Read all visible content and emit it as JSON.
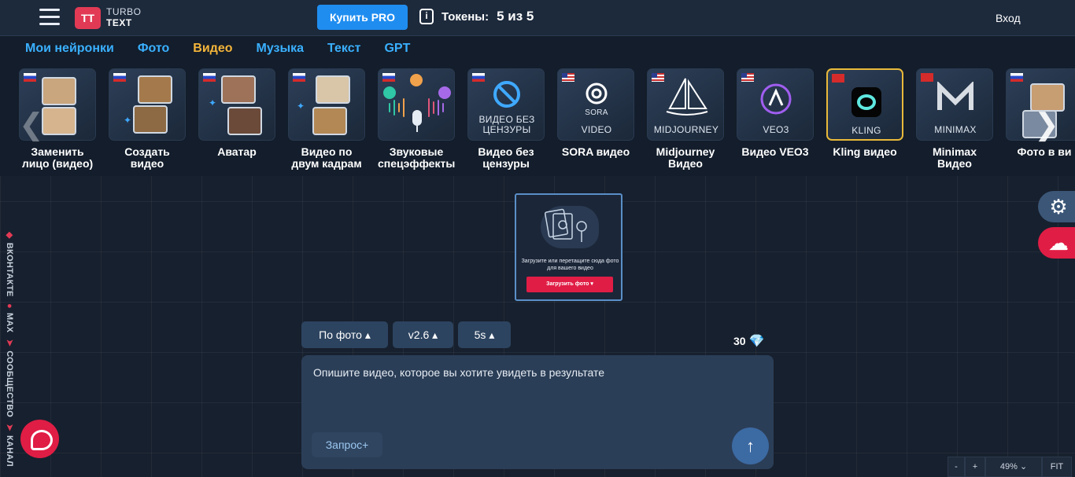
{
  "header": {
    "logo_mark": "TT",
    "logo_line1": "TURBO",
    "logo_line2": "TEXT",
    "pro_button": "Купить PRO",
    "tokens_label": "Токены:",
    "tokens_value": "5 из 5",
    "login": "Вход"
  },
  "tabs": [
    {
      "label": "Мои нейронки"
    },
    {
      "label": "Фото"
    },
    {
      "label": "Видео",
      "active": true
    },
    {
      "label": "Музыка"
    },
    {
      "label": "Текст"
    },
    {
      "label": "GPT"
    }
  ],
  "cards": [
    {
      "label": "Заменить лицо (видео)",
      "flag": "ru"
    },
    {
      "label": "Создать видео",
      "flag": "ru"
    },
    {
      "label": "Аватар",
      "flag": "ru"
    },
    {
      "label": "Видео по двум кадрам",
      "flag": "ru"
    },
    {
      "label": "Звуковые спецэффекты",
      "flag": "ru"
    },
    {
      "label": "Видео без цензуры",
      "flag": "ru",
      "cap": "ВИДЕО БЕЗ ЦЕНЗУРЫ"
    },
    {
      "label": "SORA видео",
      "flag": "us",
      "cap": "SORA",
      "cap2": "VIDEO"
    },
    {
      "label": "Midjourney Видео",
      "flag": "us",
      "cap": "MIDJOURNEY"
    },
    {
      "label": "Видео VEO3",
      "flag": "us",
      "cap": "VEO3"
    },
    {
      "label": "Kling видео",
      "flag": "cn",
      "cap": "KLING",
      "active": true
    },
    {
      "label": "Minimax Видео",
      "flag": "cn",
      "cap": "MINIMAX"
    },
    {
      "label": "Фото в ви",
      "flag": "ru"
    }
  ],
  "upload": {
    "text": "Загрузите или перетащите сюда фото для вашего видео",
    "button": "Загрузить фото"
  },
  "options": {
    "mode": "По фото",
    "version": "v2.6",
    "duration": "5s"
  },
  "cost": "30",
  "prompt": {
    "placeholder": "Опишите видео, которое вы хотите увидеть в результате",
    "request_button": "Запрос+"
  },
  "social": {
    "vk": "ВКОНТАКТЕ",
    "max": "MAX",
    "community": "СООБЩЕСТВО",
    "channel": "КАНАЛ"
  },
  "zoom": {
    "minus": "-",
    "plus": "+",
    "level": "49%",
    "fit": "FIT"
  },
  "colors": {
    "accent_blue": "#1f8df0",
    "brand_red": "#e23a55",
    "active_tab": "#f4b43a",
    "tab_link": "#3ab0ff"
  }
}
